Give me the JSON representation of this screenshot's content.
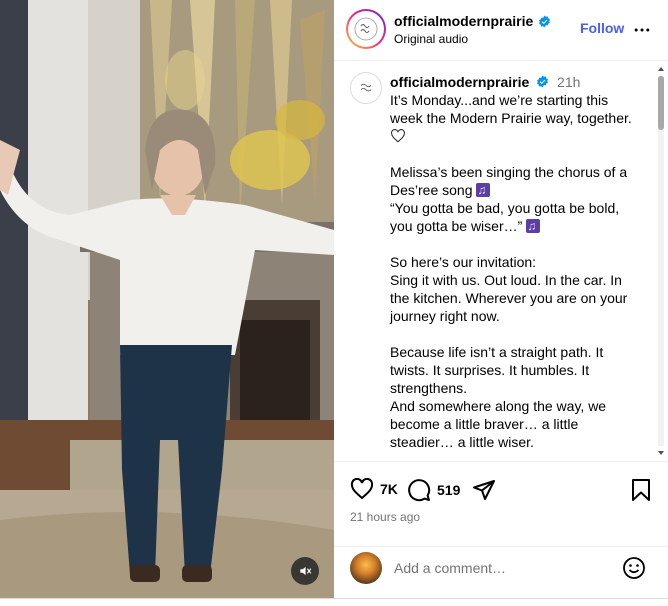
{
  "post": {
    "media": {
      "mute_icon": "speaker-muted-icon"
    },
    "header": {
      "username": "officialmodernprairie",
      "verified": true,
      "subtitle": "Original audio",
      "follow_label": "Follow",
      "more_icon": "more-dots-icon"
    },
    "caption": {
      "username": "officialmodernprairie",
      "time": "21h",
      "paragraphs": [
        [
          "It’s Monday...and we’re starting this",
          "week the Modern Prairie way, together."
        ],
        [
          "Melissa’s been singing the chorus of a",
          "Des’ree song",
          "“You gotta be bad, you gotta be bold,",
          "you gotta be wiser…”"
        ],
        [
          "So here’s our invitation:",
          "Sing it with us. Out loud. In the car. In",
          "the kitchen. Wherever you are on your",
          "journey right now."
        ],
        [
          "Because life isn’t a straight path. It",
          "twists. It surprises. It humbles. It",
          "strengthens.",
          "And somewhere along the way, we",
          "become a little braver… a little",
          "steadier… a little wiser."
        ]
      ]
    },
    "actions": {
      "likes": "7K",
      "comments": "519",
      "time_ago": "21 hours ago"
    },
    "comment_box": {
      "placeholder": "Add a comment…"
    },
    "colors": {
      "accent": "#4a5df9",
      "muted_text": "#737373",
      "verified": "#0095f6"
    }
  }
}
